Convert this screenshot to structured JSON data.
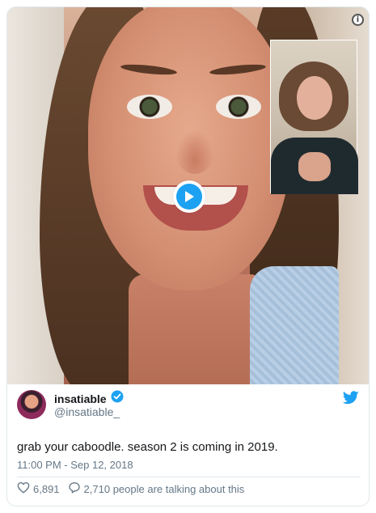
{
  "tweet": {
    "display_name": "insatiable",
    "handle": "@insatiable_",
    "verified": true,
    "text": "grab your caboodle. season 2 is coming in 2019.",
    "timestamp": "11:00 PM - Sep 12, 2018",
    "likes": "6,891",
    "conversation": "2,710 people are talking about this"
  },
  "media": {
    "type": "video",
    "play_icon": "play-icon",
    "info_icon": "info-icon"
  },
  "icons": {
    "verified": "verified-badge-icon",
    "bird": "twitter-bird-icon",
    "heart": "heart-icon",
    "reply": "speech-bubble-icon"
  },
  "colors": {
    "accent": "#1da1f2",
    "text": "#14171a",
    "secondary": "#657786",
    "border": "#e1e8ed"
  }
}
